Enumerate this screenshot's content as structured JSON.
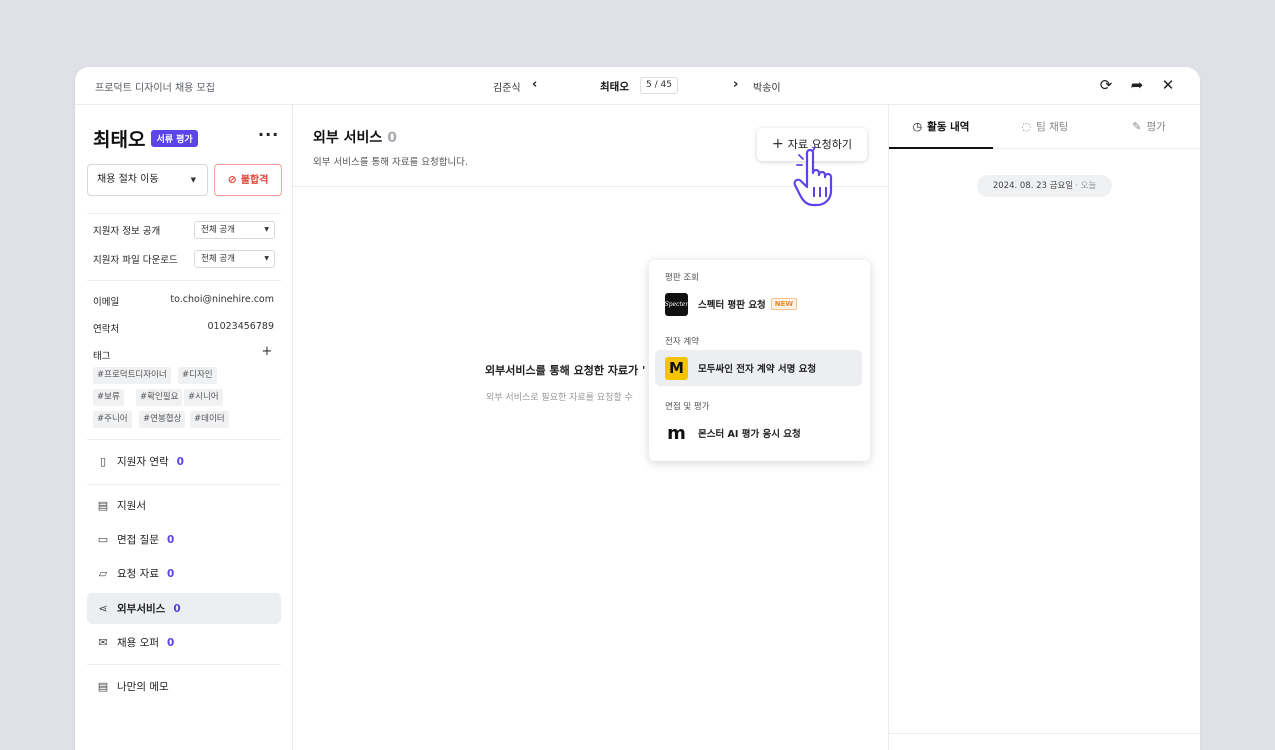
{
  "topbar": {
    "job_title": "프로덕트 디자이너 채용 모집",
    "prev_applicant": "김준식",
    "current_applicant": "최태오",
    "pager": "5 / 45",
    "next_applicant": "박송이"
  },
  "left": {
    "name": "최태오",
    "stage_badge": "서류 평가",
    "stage_select": "채용 절차 이동",
    "reject_label": "불합격",
    "settings": [
      {
        "label": "지원자 정보 공개",
        "value": "전체 공개"
      },
      {
        "label": "지원자 파일 다운로드",
        "value": "전체 공개"
      }
    ],
    "email_label": "이메일",
    "email_value": "to.choi@ninehire.com",
    "phone_label": "연락처",
    "phone_value": "01023456789",
    "tags_label": "태그",
    "tags": [
      "#프로덕트디자이너",
      "#디자인",
      "#보류",
      "#확인필요",
      "#시니어",
      "#주니어",
      "#연봉협상",
      "#데이터"
    ],
    "menu": [
      {
        "label": "지원자 연락",
        "count": "0"
      },
      {
        "label": "지원서",
        "count": ""
      },
      {
        "label": "면접 질문",
        "count": "0"
      },
      {
        "label": "요청 자료",
        "count": "0"
      },
      {
        "label": "외부서비스",
        "count": "0"
      },
      {
        "label": "채용 오퍼",
        "count": "0"
      },
      {
        "label": "나만의 메모",
        "count": ""
      }
    ]
  },
  "center": {
    "title": "외부 서비스",
    "count": "0",
    "desc": "외부 서비스를 통해 자료를 요청합니다.",
    "request_button": "자료 요청하기",
    "empty_title": "외부서비스를 통해 요청한 자료가 '",
    "empty_desc": "외부 서비스로 필요한 자료를 요청할 수"
  },
  "dropdown": {
    "groups": [
      {
        "label": "평판 조회",
        "item": "스펙터 평판 요청",
        "badge": "NEW",
        "logo_text": "Specter"
      },
      {
        "label": "전자 계약",
        "item": "모두싸인 전자 계약 서명 요청",
        "badge": "",
        "logo_text": "M"
      },
      {
        "label": "면접 및 평가",
        "item": "몬스터 AI 평가 응시 요청",
        "badge": "",
        "logo_text": "m"
      }
    ]
  },
  "right": {
    "tabs": [
      "활동 내역",
      "팀 채팅",
      "평가"
    ],
    "date": "2024. 08. 23 금요일",
    "today": "· 오늘"
  },
  "colors": {
    "accent": "#5b44e8",
    "danger": "#e24a3b",
    "modusign_yellow": "#f5c400",
    "new_badge": "#e6872a"
  }
}
